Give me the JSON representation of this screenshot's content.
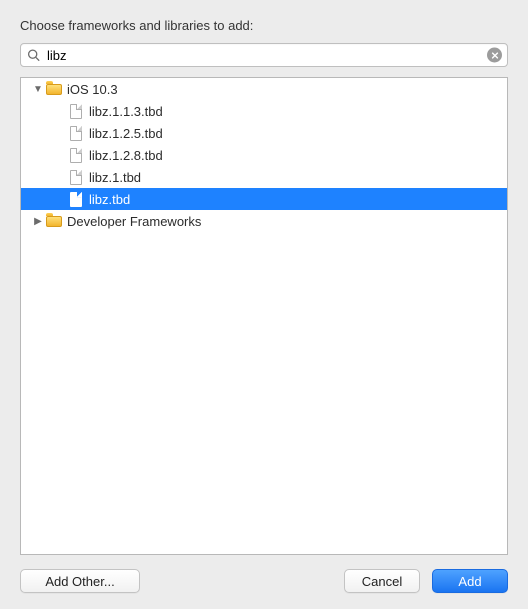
{
  "title": "Choose frameworks and libraries to add:",
  "search": {
    "value": "libz",
    "placeholder": "Search"
  },
  "tree": [
    {
      "depth": 0,
      "type": "folder",
      "expanded": true,
      "label": "iOS 10.3",
      "selected": false
    },
    {
      "depth": 1,
      "type": "file",
      "expanded": false,
      "label": "libz.1.1.3.tbd",
      "selected": false
    },
    {
      "depth": 1,
      "type": "file",
      "expanded": false,
      "label": "libz.1.2.5.tbd",
      "selected": false
    },
    {
      "depth": 1,
      "type": "file",
      "expanded": false,
      "label": "libz.1.2.8.tbd",
      "selected": false
    },
    {
      "depth": 1,
      "type": "file",
      "expanded": false,
      "label": "libz.1.tbd",
      "selected": false
    },
    {
      "depth": 1,
      "type": "file",
      "expanded": false,
      "label": "libz.tbd",
      "selected": true
    },
    {
      "depth": 0,
      "type": "folder",
      "expanded": false,
      "label": "Developer Frameworks",
      "selected": false
    }
  ],
  "buttons": {
    "add_other": "Add Other...",
    "cancel": "Cancel",
    "add": "Add"
  }
}
